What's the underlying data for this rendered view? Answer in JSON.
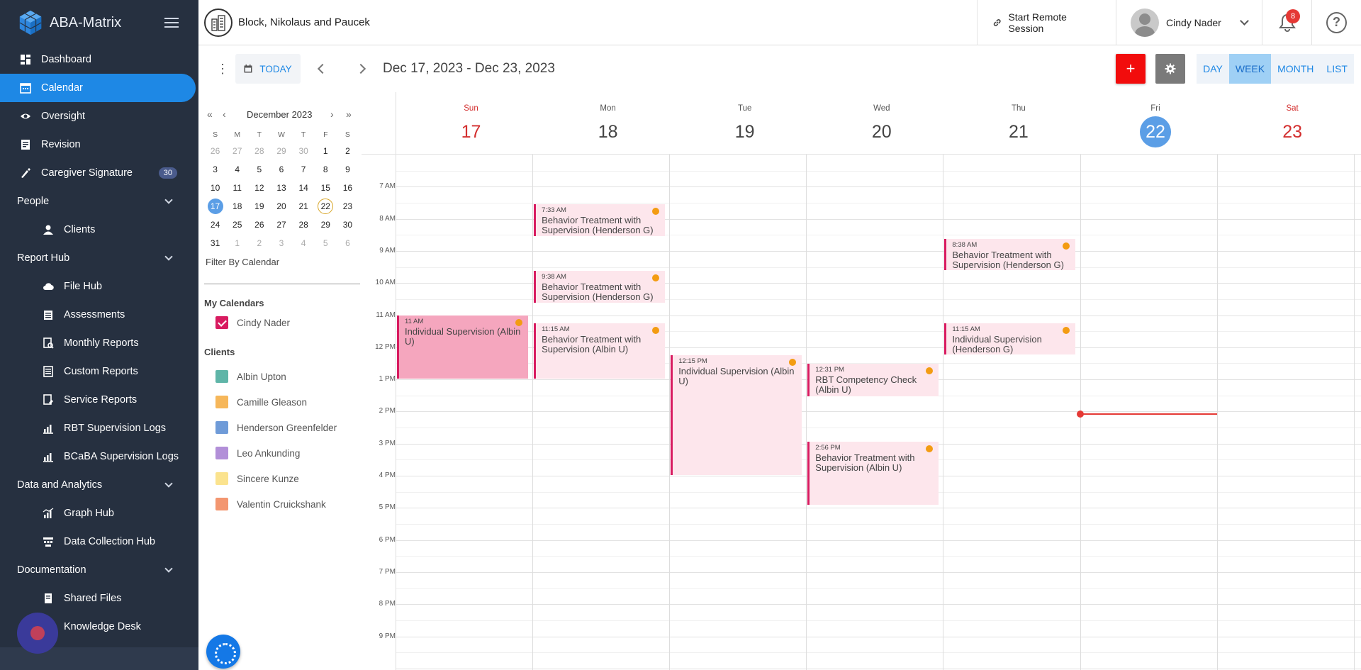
{
  "app": {
    "title": "ABA-Matrix"
  },
  "sidebar": {
    "items": [
      {
        "label": "Dashboard",
        "kind": "top",
        "icon": "dashboard-icon"
      },
      {
        "label": "Calendar",
        "kind": "top",
        "icon": "calendar-icon",
        "active": true
      },
      {
        "label": "Oversight",
        "kind": "top",
        "icon": "eye-icon"
      },
      {
        "label": "Revision",
        "kind": "top",
        "icon": "revision-icon"
      },
      {
        "label": "Caregiver Signature",
        "kind": "top",
        "icon": "signature-icon",
        "badge": "30"
      },
      {
        "label": "People",
        "kind": "section"
      },
      {
        "label": "Clients",
        "kind": "sub",
        "icon": "user-icon"
      },
      {
        "label": "Report Hub",
        "kind": "section"
      },
      {
        "label": "File Hub",
        "kind": "sub",
        "icon": "cloud-icon"
      },
      {
        "label": "Assessments",
        "kind": "sub",
        "icon": "assessment-icon"
      },
      {
        "label": "Monthly Reports",
        "kind": "sub",
        "icon": "report-icon"
      },
      {
        "label": "Custom Reports",
        "kind": "sub",
        "icon": "document-icon"
      },
      {
        "label": "Service Reports",
        "kind": "sub",
        "icon": "service-report-icon"
      },
      {
        "label": "RBT Supervision Logs",
        "kind": "sub",
        "icon": "chart-icon"
      },
      {
        "label": "BCaBA Supervision Logs",
        "kind": "sub",
        "icon": "chart-icon"
      },
      {
        "label": "Data and Analytics",
        "kind": "section"
      },
      {
        "label": "Graph Hub",
        "kind": "sub",
        "icon": "graph-icon"
      },
      {
        "label": "Data Collection Hub",
        "kind": "sub",
        "icon": "data-icon"
      },
      {
        "label": "Documentation",
        "kind": "section"
      },
      {
        "label": "Shared Files",
        "kind": "sub",
        "icon": "shared-files-icon"
      },
      {
        "label": "Knowledge Desk",
        "kind": "sub",
        "icon": "knowledge-icon"
      }
    ]
  },
  "topbar": {
    "org_name": "Block, Nikolaus and Paucek",
    "remote_label": "Start Remote Session",
    "user_name": "Cindy Nader",
    "notification_count": "8",
    "help_glyph": "?"
  },
  "toolbar": {
    "today_label": "TODAY",
    "date_range": "Dec 17, 2023 - Dec 23, 2023",
    "add_glyph": "+",
    "views": [
      {
        "label": "DAY",
        "active": false
      },
      {
        "label": "WEEK",
        "active": true
      },
      {
        "label": "MONTH",
        "active": false
      },
      {
        "label": "LIST",
        "active": false
      }
    ]
  },
  "mini_calendar": {
    "month_label": "December 2023",
    "nav": {
      "dbl_prev": "«",
      "prev": "‹",
      "next": "›",
      "dbl_next": "»"
    },
    "dow": [
      "S",
      "M",
      "T",
      "W",
      "T",
      "F",
      "S"
    ],
    "weeks": [
      [
        [
          "26",
          1
        ],
        [
          "27",
          1
        ],
        [
          "28",
          1
        ],
        [
          "29",
          1
        ],
        [
          "30",
          1
        ],
        [
          "1",
          0
        ],
        [
          "2",
          0
        ]
      ],
      [
        [
          "3",
          0
        ],
        [
          "4",
          0
        ],
        [
          "5",
          0
        ],
        [
          "6",
          0
        ],
        [
          "7",
          0
        ],
        [
          "8",
          0
        ],
        [
          "9",
          0
        ]
      ],
      [
        [
          "10",
          0
        ],
        [
          "11",
          0
        ],
        [
          "12",
          0
        ],
        [
          "13",
          0
        ],
        [
          "14",
          0
        ],
        [
          "15",
          0
        ],
        [
          "16",
          0
        ]
      ],
      [
        [
          "17",
          2
        ],
        [
          "18",
          0
        ],
        [
          "19",
          0
        ],
        [
          "20",
          0
        ],
        [
          "21",
          0
        ],
        [
          "22",
          3
        ],
        [
          "23",
          0
        ]
      ],
      [
        [
          "24",
          0
        ],
        [
          "25",
          0
        ],
        [
          "26",
          0
        ],
        [
          "27",
          0
        ],
        [
          "28",
          0
        ],
        [
          "29",
          0
        ],
        [
          "30",
          0
        ]
      ],
      [
        [
          "31",
          0
        ],
        [
          "1",
          1
        ],
        [
          "2",
          1
        ],
        [
          "3",
          1
        ],
        [
          "4",
          1
        ],
        [
          "5",
          1
        ],
        [
          "6",
          1
        ]
      ]
    ]
  },
  "filters": {
    "label": "Filter By Calendar",
    "my_calendars_heading": "My Calendars",
    "my_calendars": [
      {
        "label": "Cindy Nader",
        "color": "#d81b60",
        "checked": true
      }
    ],
    "clients_heading": "Clients",
    "clients": [
      {
        "label": "Albin Upton",
        "color": "#5fb5a8"
      },
      {
        "label": "Camille Gleason",
        "color": "#f6b75a"
      },
      {
        "label": "Henderson Greenfelder",
        "color": "#6f9bd8"
      },
      {
        "label": "Leo Ankunding",
        "color": "#b28fd8"
      },
      {
        "label": "Sincere Kunze",
        "color": "#fbe38e"
      },
      {
        "label": "Valentin Cruickshank",
        "color": "#f39670"
      }
    ]
  },
  "week": {
    "days": [
      {
        "dow": "Sun",
        "num": "17",
        "weekend": true
      },
      {
        "dow": "Mon",
        "num": "18"
      },
      {
        "dow": "Tue",
        "num": "19"
      },
      {
        "dow": "Wed",
        "num": "20"
      },
      {
        "dow": "Thu",
        "num": "21"
      },
      {
        "dow": "Fri",
        "num": "22",
        "current": true
      },
      {
        "dow": "Sat",
        "num": "23",
        "weekend": true
      }
    ],
    "hours": [
      "7 AM",
      "8 AM",
      "9 AM",
      "10 AM",
      "11 AM",
      "12 PM",
      "1 PM",
      "2 PM",
      "3 PM",
      "4 PM",
      "5 PM",
      "6 PM",
      "7 PM",
      "8 PM",
      "9 PM"
    ],
    "events": [
      {
        "day": 1,
        "start": 7.55,
        "end": 8.55,
        "time": "7:33 AM",
        "title": "Behavior Treatment with Supervision (Henderson G)"
      },
      {
        "day": 1,
        "start": 9.63,
        "end": 10.63,
        "time": "9:38 AM",
        "title": "Behavior Treatment with Supervision (Henderson G)"
      },
      {
        "day": 1,
        "start": 11.25,
        "end": 13.0,
        "time": "11:15 AM",
        "title": "Behavior Treatment with Supervision (Albin U)"
      },
      {
        "day": 0,
        "start": 11.0,
        "end": 13.0,
        "time": "11 AM",
        "title": "Individual Supervision (Albin U)",
        "strong": true
      },
      {
        "day": 2,
        "start": 12.25,
        "end": 16.0,
        "time": "12:15 PM",
        "title": "Individual Supervision (Albin U)"
      },
      {
        "day": 3,
        "start": 12.52,
        "end": 13.55,
        "time": "12:31 PM",
        "title": "RBT Competency Check (Albin U)"
      },
      {
        "day": 3,
        "start": 14.93,
        "end": 16.93,
        "time": "2:56 PM",
        "title": "Behavior Treatment with Supervision (Albin U)"
      },
      {
        "day": 4,
        "start": 8.63,
        "end": 9.63,
        "time": "8:38 AM",
        "title": "Behavior Treatment with Supervision (Henderson G)"
      },
      {
        "day": 4,
        "start": 11.25,
        "end": 12.25,
        "time": "11:15 AM",
        "title": "Individual Supervision (Henderson G)"
      }
    ],
    "now": {
      "day": 5,
      "hour": 14.05
    },
    "accent_color": "#d81b60"
  }
}
